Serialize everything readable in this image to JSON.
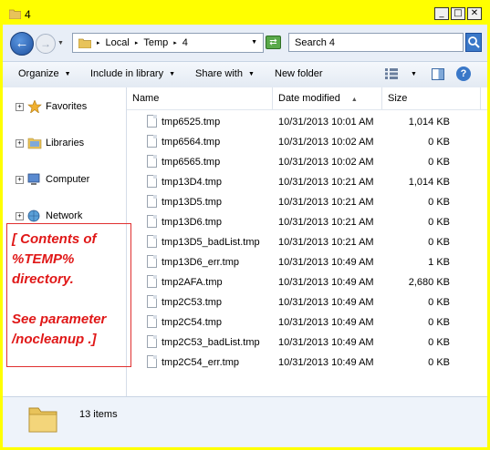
{
  "window": {
    "title": "4",
    "controls": [
      "_",
      "□",
      "✕"
    ]
  },
  "address": {
    "breadcrumbs": [
      "Local",
      "Temp",
      "4"
    ],
    "search_placeholder": "Search 4"
  },
  "toolbar": {
    "organize": "Organize",
    "include_in_library": "Include in library",
    "share_with": "Share with",
    "new_folder": "New folder",
    "help": "?"
  },
  "nav": {
    "items": [
      {
        "label": "Favorites",
        "icon": "star-icon"
      },
      {
        "label": "Libraries",
        "icon": "libraries-icon"
      },
      {
        "label": "Computer",
        "icon": "computer-icon"
      },
      {
        "label": "Network",
        "icon": "network-icon"
      }
    ]
  },
  "note": {
    "lines": [
      "[ Contents of",
      "%TEMP%",
      "directory.",
      "",
      "See parameter",
      "/nocleanup .]"
    ]
  },
  "columns": {
    "name": "Name",
    "date": "Date modified",
    "size": "Size"
  },
  "files": [
    {
      "name": "tmp6525.tmp",
      "date": "10/31/2013 10:01 AM",
      "size": "1,014 KB"
    },
    {
      "name": "tmp6564.tmp",
      "date": "10/31/2013 10:02 AM",
      "size": "0 KB"
    },
    {
      "name": "tmp6565.tmp",
      "date": "10/31/2013 10:02 AM",
      "size": "0 KB"
    },
    {
      "name": "tmp13D4.tmp",
      "date": "10/31/2013 10:21 AM",
      "size": "1,014 KB"
    },
    {
      "name": "tmp13D5.tmp",
      "date": "10/31/2013 10:21 AM",
      "size": "0 KB"
    },
    {
      "name": "tmp13D6.tmp",
      "date": "10/31/2013 10:21 AM",
      "size": "0 KB"
    },
    {
      "name": "tmp13D5_badList.tmp",
      "date": "10/31/2013 10:21 AM",
      "size": "0 KB"
    },
    {
      "name": "tmp13D6_err.tmp",
      "date": "10/31/2013 10:49 AM",
      "size": "1 KB"
    },
    {
      "name": "tmp2AFA.tmp",
      "date": "10/31/2013 10:49 AM",
      "size": "2,680 KB"
    },
    {
      "name": "tmp2C53.tmp",
      "date": "10/31/2013 10:49 AM",
      "size": "0 KB"
    },
    {
      "name": "tmp2C54.tmp",
      "date": "10/31/2013 10:49 AM",
      "size": "0 KB"
    },
    {
      "name": "tmp2C53_badList.tmp",
      "date": "10/31/2013 10:49 AM",
      "size": "0 KB"
    },
    {
      "name": "tmp2C54_err.tmp",
      "date": "10/31/2013 10:49 AM",
      "size": "0 KB"
    }
  ],
  "status": {
    "item_count": "13 items"
  },
  "colors": {
    "frame": "#ffff00",
    "accent": "#3a78c8",
    "note": "#e01818"
  }
}
